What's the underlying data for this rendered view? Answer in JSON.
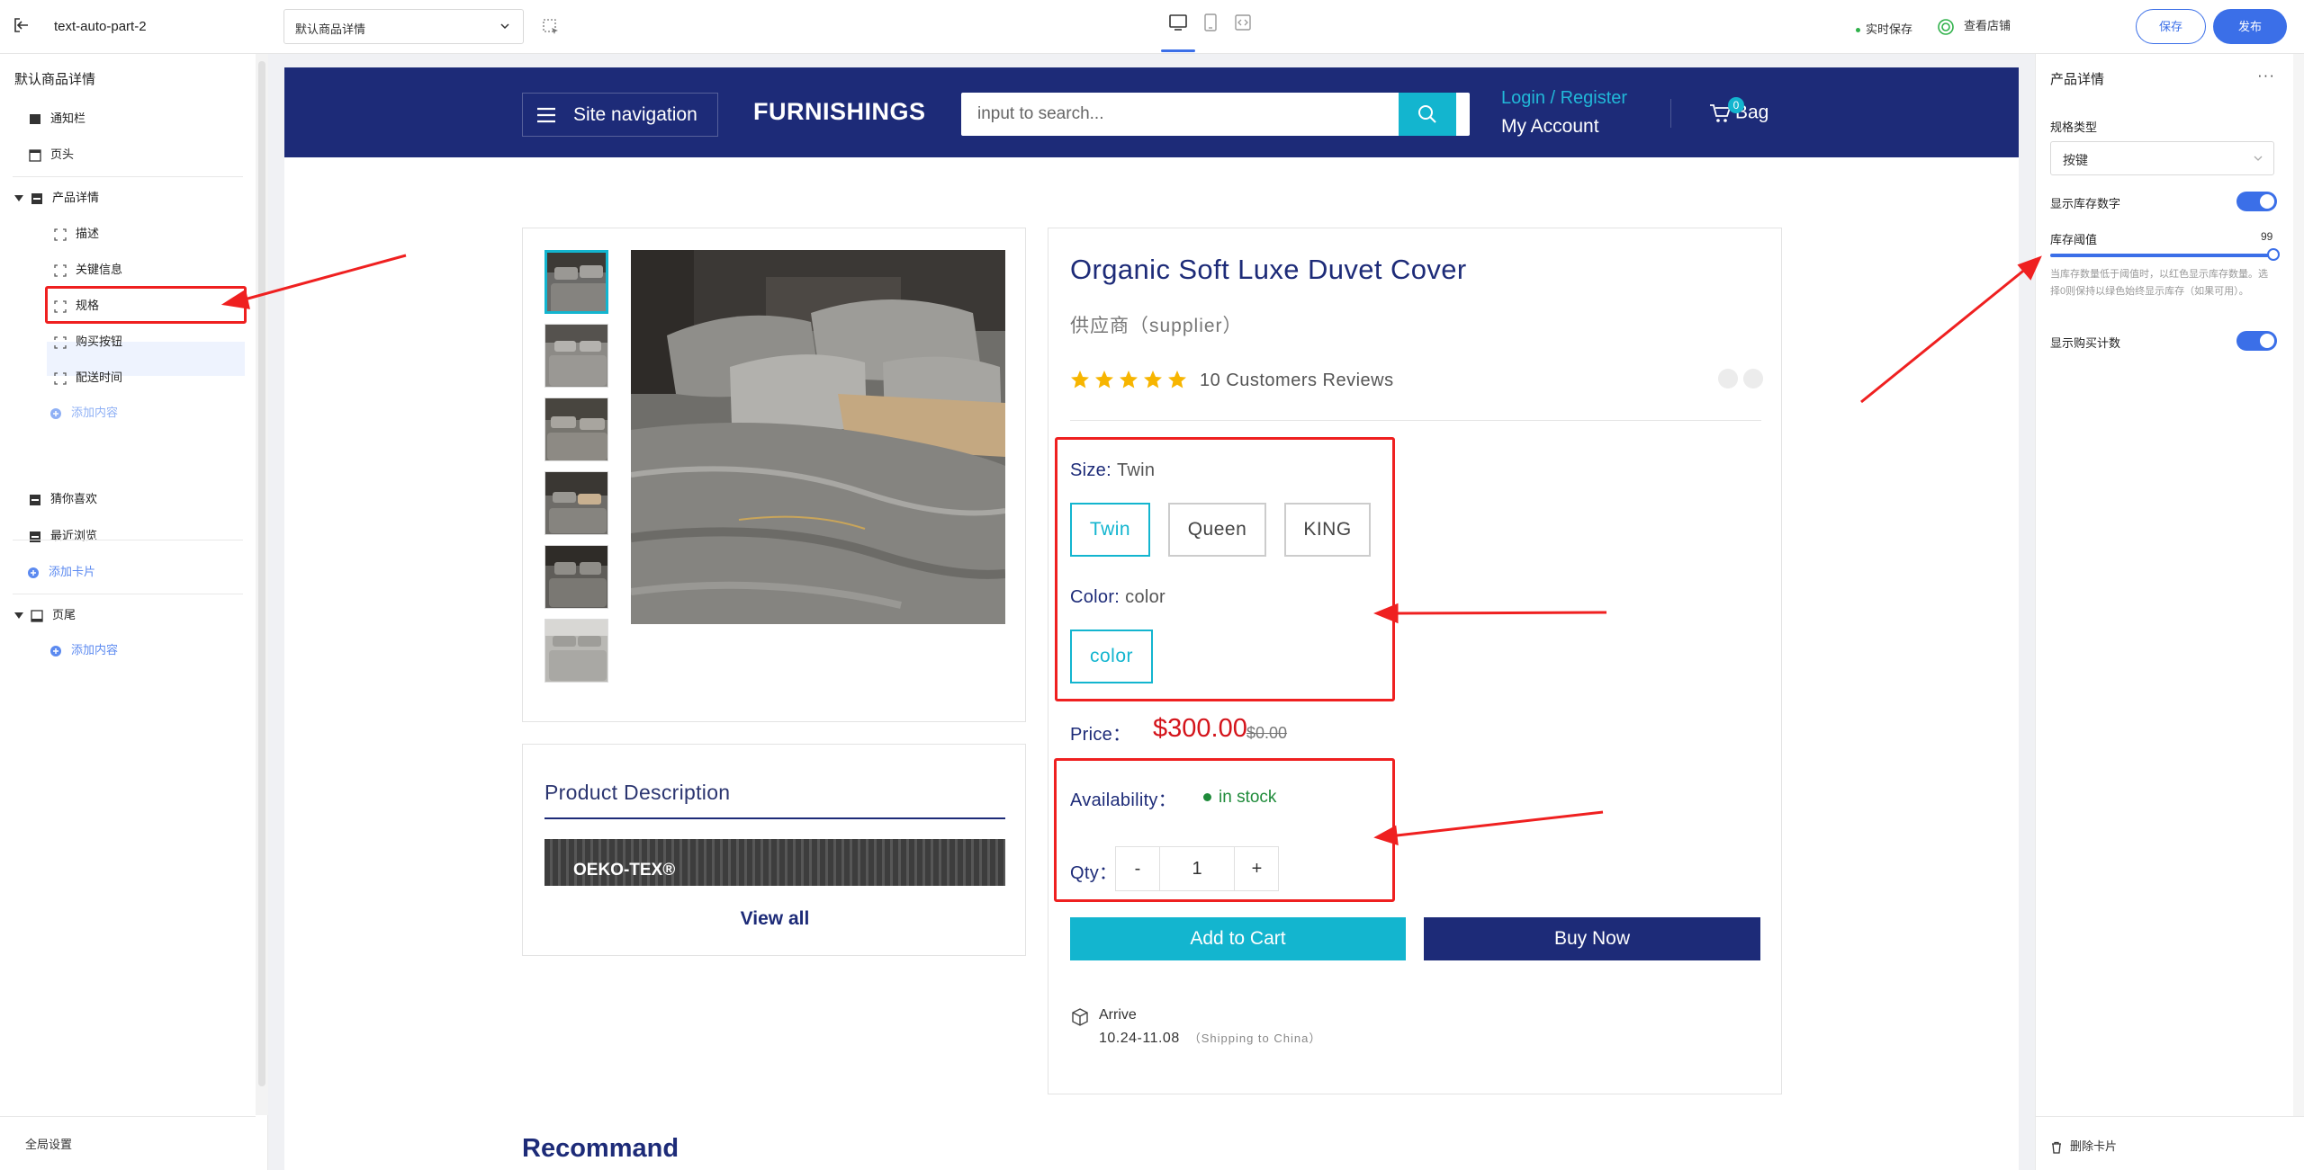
{
  "topbar": {
    "project_name": "text-auto-part-2",
    "page_select_value": "默认商品详情",
    "autosave_label": "实时保存",
    "view_store_label": "查看店铺",
    "save_label": "保存",
    "publish_label": "发布",
    "active_device": "desktop"
  },
  "sidebar": {
    "title": "默认商品详情",
    "items": [
      {
        "label": "通知栏"
      },
      {
        "label": "页头"
      },
      {
        "label": "产品详情"
      },
      {
        "label": "描述"
      },
      {
        "label": "关键信息"
      },
      {
        "label": "规格"
      },
      {
        "label": "购买按钮"
      },
      {
        "label": "配送时间"
      },
      {
        "label": "添加内容"
      },
      {
        "label": "猜你喜欢"
      },
      {
        "label": "最近浏览"
      },
      {
        "label": "添加卡片"
      },
      {
        "label": "页尾"
      },
      {
        "label": "添加内容"
      }
    ],
    "selected_item": "规格",
    "global_settings_label": "全局设置"
  },
  "store": {
    "nav_label": "Site navigation",
    "brand": "FURNISHINGS",
    "search_placeholder": "input to search...",
    "login_label": "Login / Register",
    "account_label": "My Account",
    "bag_label": "Bag",
    "bag_count": "0",
    "colors": {
      "header": "#1d2b78",
      "accent": "#13b5cf",
      "price": "#d4141b"
    }
  },
  "product": {
    "title": "Organic Soft Luxe Duvet Cover",
    "supplier": "供应商（supplier）",
    "rating": 5,
    "reviews_label": "10 Customers Reviews",
    "size_label": "Size:",
    "size_value": "Twin",
    "size_options": [
      "Twin",
      "Queen",
      "KING"
    ],
    "color_label": "Color:",
    "color_value": "color",
    "color_options": [
      "color"
    ],
    "price_label": "Price：",
    "price": "$300.00",
    "old_price": "$0.00",
    "availability_label": "Availability：",
    "availability_value": "in stock",
    "qty_label": "Qty：",
    "qty_minus": "-",
    "qty_value": "1",
    "qty_plus": "+",
    "add_to_cart_label": "Add to Cart",
    "buy_now_label": "Buy Now",
    "arrive_label": "Arrive",
    "arrive_dates": "10.24-11.08",
    "shipping_note": "（Shipping to China）"
  },
  "description": {
    "title": "Product Description",
    "banner_text": "OEKO-TEX®",
    "view_all_label": "View all"
  },
  "recommend_title": "Recommand",
  "right_panel": {
    "title": "产品详情",
    "more_label": "···",
    "spec_type_label": "规格类型",
    "spec_type_value": "按键",
    "show_stock_label": "显示库存数字",
    "show_stock_on": true,
    "stock_threshold_label": "库存阈值",
    "stock_threshold_value": "99",
    "stock_threshold_fraction": 0.99,
    "stock_hint": "当库存数量低于阈值时，以红色显示库存数量。选择0则保持以绿色始终显示库存（如果可用）。",
    "show_purchase_count_label": "显示购买计数",
    "show_purchase_count_on": true,
    "delete_card_label": "删除卡片"
  }
}
